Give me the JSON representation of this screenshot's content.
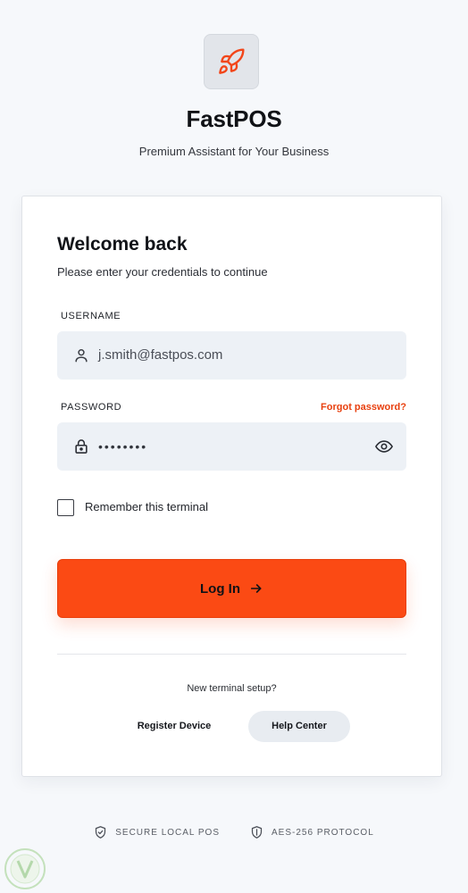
{
  "brand": {
    "icon": "rocket-icon",
    "title": "FastPOS",
    "subtitle": "Premium Assistant for Your Business",
    "accent_color": "#fb4a14"
  },
  "form": {
    "heading": "Welcome back",
    "subheading": "Please enter your credentials to continue",
    "username": {
      "label": "USERNAME",
      "value": "j.smith@fastpos.com",
      "icon": "user-icon"
    },
    "password": {
      "label": "PASSWORD",
      "masked_value": "••••••••",
      "icon": "lock-icon",
      "toggle_icon": "eye-icon",
      "forgot_label": "Forgot password?"
    },
    "remember": {
      "label": "Remember this terminal",
      "checked": false
    },
    "submit_label": "Log In",
    "submit_icon": "arrow-right-icon"
  },
  "setup": {
    "prompt": "New terminal setup?",
    "register_label": "Register Device",
    "help_label": "Help Center"
  },
  "footer": {
    "items": [
      {
        "icon": "shield-check-icon",
        "label": "SECURE LOCAL POS"
      },
      {
        "icon": "shield-icon",
        "label": "AES-256 PROTOCOL"
      }
    ]
  }
}
